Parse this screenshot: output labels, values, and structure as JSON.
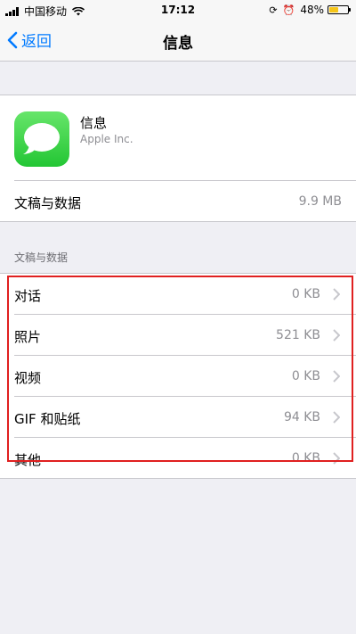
{
  "status_bar": {
    "carrier": "中国移动",
    "time": "17:12",
    "battery_percent": "48%",
    "battery_level": 0.48,
    "battery_color": "#f5c519"
  },
  "nav": {
    "back_label": "返回",
    "title": "信息"
  },
  "app": {
    "name": "信息",
    "developer": "Apple Inc.",
    "storage_label": "文稿与数据",
    "storage_value": "9.9 MB",
    "icon": "messages-app-icon"
  },
  "section": {
    "header": "文稿与数据",
    "items": [
      {
        "label": "对话",
        "value": "0 KB"
      },
      {
        "label": "照片",
        "value": "521 KB"
      },
      {
        "label": "视频",
        "value": "0 KB"
      },
      {
        "label": "GIF 和贴纸",
        "value": "94 KB"
      },
      {
        "label": "其他",
        "value": "0 KB"
      }
    ]
  },
  "colors": {
    "accent": "#007aff",
    "highlight": "#e02020",
    "app_icon": "#34c759"
  }
}
